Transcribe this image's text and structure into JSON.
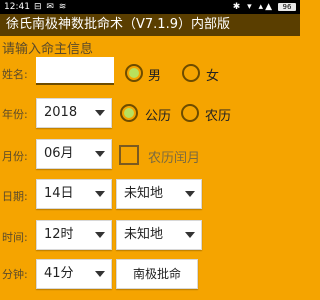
{
  "status": {
    "time": "12:41",
    "battery": "96",
    "left_icons": "⊟ ✉ ≋",
    "right_icons": "✱ ▾ ▴▲"
  },
  "app": {
    "title": "徐氏南极神数批命术（V7.1.9）内部版"
  },
  "form": {
    "prompt": "请输入命主信息",
    "name_label": "姓名:",
    "name_value": "",
    "gender_male": "男",
    "gender_female": "女",
    "gender_selected": "男",
    "year_label": "年份:",
    "year_value": "2018",
    "calendar_solar": "公历",
    "calendar_lunar": "农历",
    "calendar_selected": "公历",
    "month_label": "月份:",
    "month_value": "06月",
    "leap_month_label": "农历闰月",
    "day_label": "日期:",
    "day_value": "14日",
    "day_place_value": "未知地",
    "hour_label": "时间:",
    "hour_value": "12时",
    "hour_place_value": "未知地",
    "minute_label": "分钟:",
    "minute_value": "41分",
    "submit_label": "南极批命"
  }
}
